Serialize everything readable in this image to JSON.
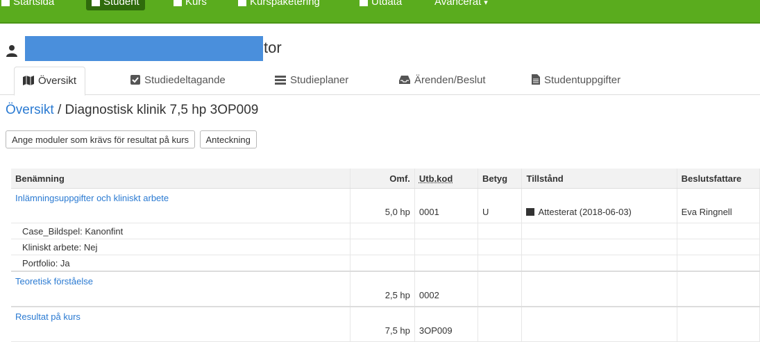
{
  "nav": {
    "items": [
      {
        "label": "Startsida"
      },
      {
        "label": "Student"
      },
      {
        "label": "Kurs"
      },
      {
        "label": "Kurspaketering"
      },
      {
        "label": "Utdata"
      },
      {
        "label": "Avancerat"
      }
    ]
  },
  "student": {
    "name_suffix": "tor"
  },
  "tabs": [
    {
      "label": "Översikt"
    },
    {
      "label": "Studiedeltagande"
    },
    {
      "label": "Studieplaner"
    },
    {
      "label": "Ärenden/Beslut"
    },
    {
      "label": "Studentuppgifter"
    }
  ],
  "breadcrumb": {
    "link": "Översikt",
    "sep": " / ",
    "title": "Diagnostisk klinik 7,5 hp 3OP009"
  },
  "buttons": {
    "modules": "Ange moduler som krävs för resultat på kurs",
    "note": "Anteckning"
  },
  "table": {
    "headers": {
      "name": "Benämning",
      "omf": "Omf.",
      "code": "Utb.kod",
      "grade": "Betyg",
      "status": "Tillstånd",
      "decider": "Beslutsfattare"
    },
    "rows": [
      {
        "name": "Inlämningsuppgifter och kliniskt arbete",
        "omf": "5,0 hp",
        "code": "0001",
        "grade": "U",
        "status": "Attesterat (2018-06-03)",
        "decider": "Eva Ringnell"
      },
      {
        "name": "Case_Bildspel: Kanonfint"
      },
      {
        "name": "Kliniskt arbete: Nej"
      },
      {
        "name": "Portfolio: Ja"
      },
      {
        "name": "Teoretisk förståelse",
        "omf": "2,5 hp",
        "code": "0002"
      },
      {
        "name": "Resultat på kurs",
        "omf": "7,5 hp",
        "code": "3OP009"
      }
    ]
  }
}
